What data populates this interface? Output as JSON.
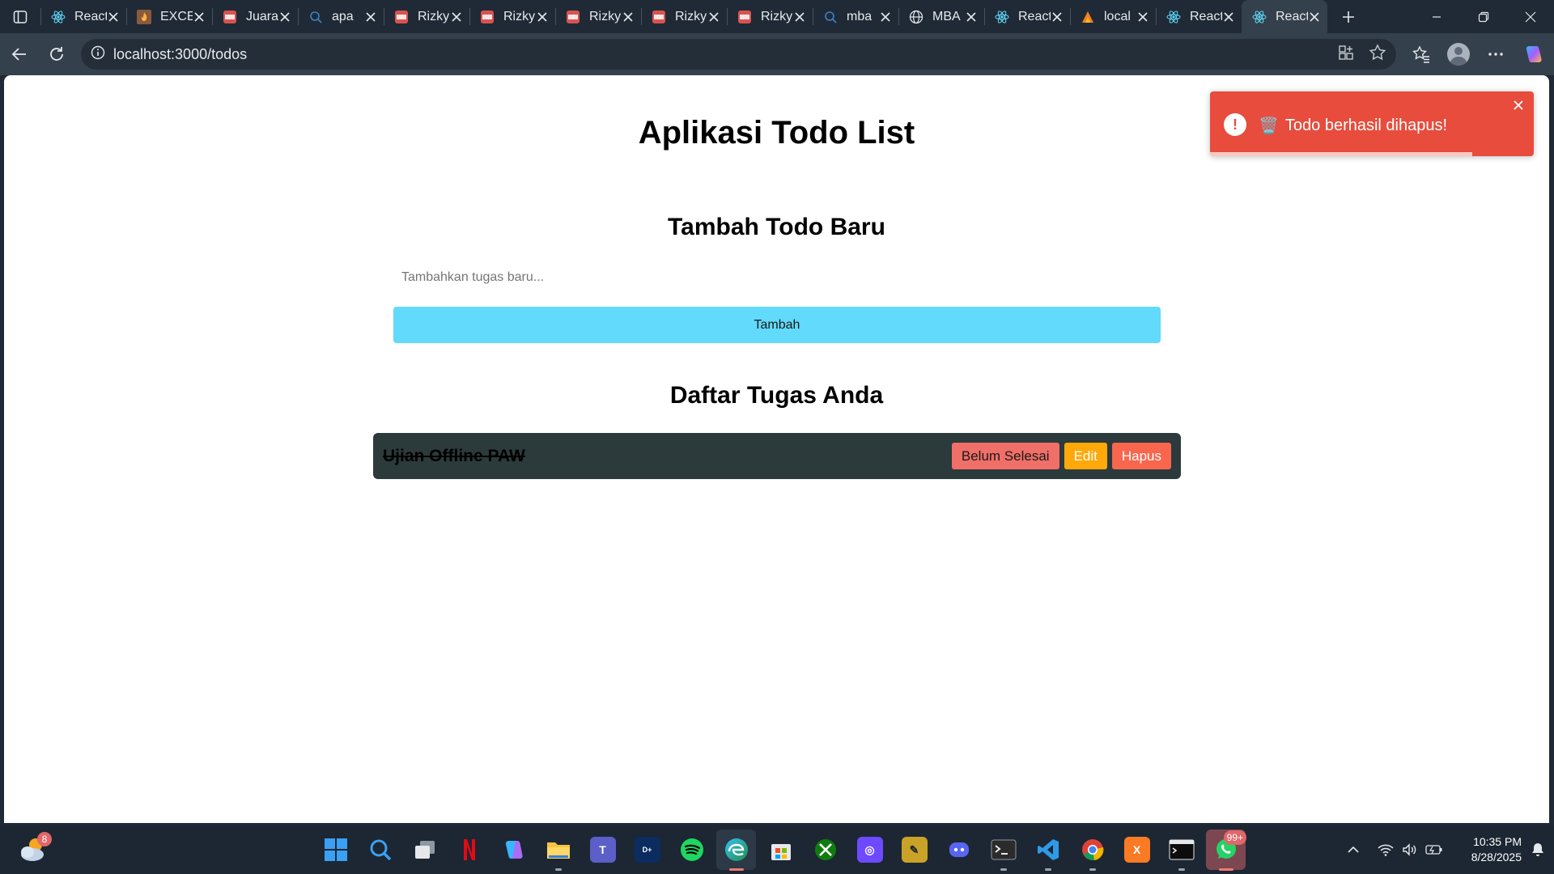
{
  "browser": {
    "tabs": [
      {
        "label": "React",
        "icon": "react-icon"
      },
      {
        "label": "EXCEL",
        "icon": "flame-icon"
      },
      {
        "label": "Juara",
        "icon": "pdf-icon"
      },
      {
        "label": "apa",
        "icon": "search-icon"
      },
      {
        "label": "Rizky",
        "icon": "pdf-icon"
      },
      {
        "label": "Rizky",
        "icon": "pdf-icon"
      },
      {
        "label": "Rizky",
        "icon": "pdf-icon"
      },
      {
        "label": "Rizky",
        "icon": "pdf-icon"
      },
      {
        "label": "Rizky",
        "icon": "pdf-icon"
      },
      {
        "label": "mba",
        "icon": "search-icon"
      },
      {
        "label": "MBA",
        "icon": "globe-icon"
      },
      {
        "label": "React",
        "icon": "react-icon"
      },
      {
        "label": "local",
        "icon": "xampp-icon"
      },
      {
        "label": "React",
        "icon": "react-icon"
      },
      {
        "label": "React",
        "icon": "react-icon",
        "active": true
      }
    ],
    "address": "localhost:3000/todos"
  },
  "app": {
    "title": "Aplikasi Todo List",
    "add_section_title": "Tambah Todo Baru",
    "input_placeholder": "Tambahkan tugas baru...",
    "add_button": "Tambah",
    "list_title": "Daftar Tugas Anda",
    "todos": [
      {
        "text": "Ujian Offline PAW",
        "completed": true,
        "actions": {
          "toggle": "Belum Selesai",
          "edit": "Edit",
          "delete": "Hapus"
        }
      }
    ]
  },
  "toast": {
    "emoji": "🗑️",
    "message": "Todo berhasil dihapus!",
    "progress": 0.81,
    "color": "#e74c3c"
  },
  "taskbar": {
    "weather_badge": "8",
    "whatsapp_badge": "99+",
    "apps": [
      "start-icon",
      "search-icon",
      "task-view-icon",
      "netflix-icon",
      "copilot-icon",
      "file-explorer-icon",
      "teams-icon",
      "disney-plus-icon",
      "spotify-icon",
      "edge-icon",
      "store-icon",
      "xbox-icon",
      "proton-icon",
      "photo-icon",
      "discord-icon",
      "terminal-icon",
      "vscode-icon",
      "chrome-icon",
      "xampp-icon",
      "cmd-icon",
      "whatsapp-icon"
    ],
    "time": "10:35 PM",
    "date": "8/28/2025"
  },
  "colors": {
    "accent_button": "#61dafb",
    "todo_bg": "#2c3a3b",
    "undone_button": "#f06f68",
    "edit_button": "#ffa80a",
    "delete_button": "#f8664d"
  }
}
